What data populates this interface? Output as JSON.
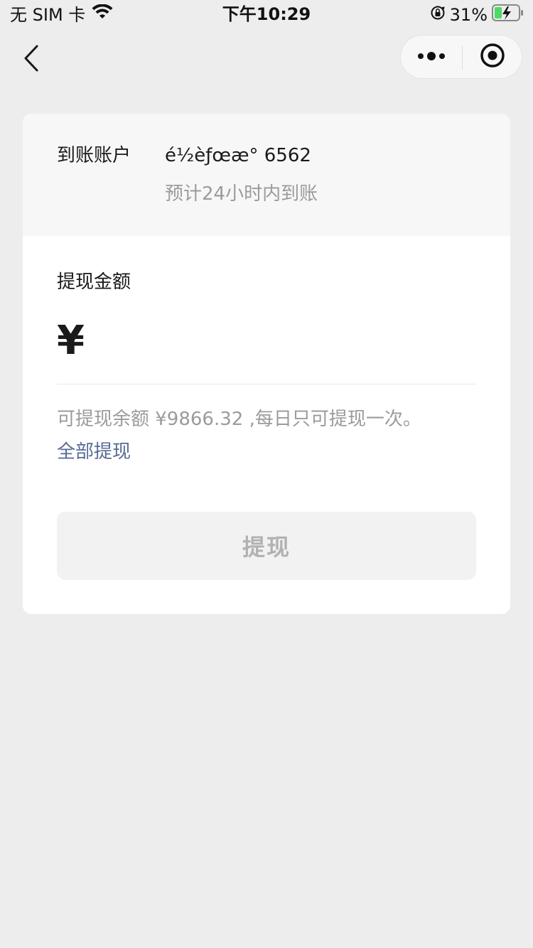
{
  "status_bar": {
    "carrier": "无 SIM 卡",
    "time": "下午10:29",
    "battery_percent": "31%",
    "battery_level": 0.31,
    "icons": [
      "wifi-icon",
      "orientation-lock-icon",
      "battery-charging-icon"
    ]
  },
  "nav": {
    "icons": [
      "back-arrow-icon",
      "more-dots-icon",
      "close-target-icon"
    ]
  },
  "account": {
    "label": "到账账户",
    "name": "é½èƒœæ° 6562",
    "eta": "预计24小时内到账"
  },
  "withdraw": {
    "amount_label": "提现金额",
    "currency_symbol": "¥",
    "amount_value": "",
    "balance_note": "可提现余额 ¥9866.32 ,每日只可提现一次。",
    "withdraw_all_label": "全部提现",
    "submit_label": "提现"
  },
  "colors": {
    "background": "#ededed",
    "card": "#ffffff",
    "account_section": "#f7f7f7",
    "link": "#576b95",
    "muted_text": "#9b9b9b",
    "button_disabled_bg": "#f2f2f2",
    "button_disabled_text": "#b2b2b2",
    "battery_green": "#4cd964"
  }
}
